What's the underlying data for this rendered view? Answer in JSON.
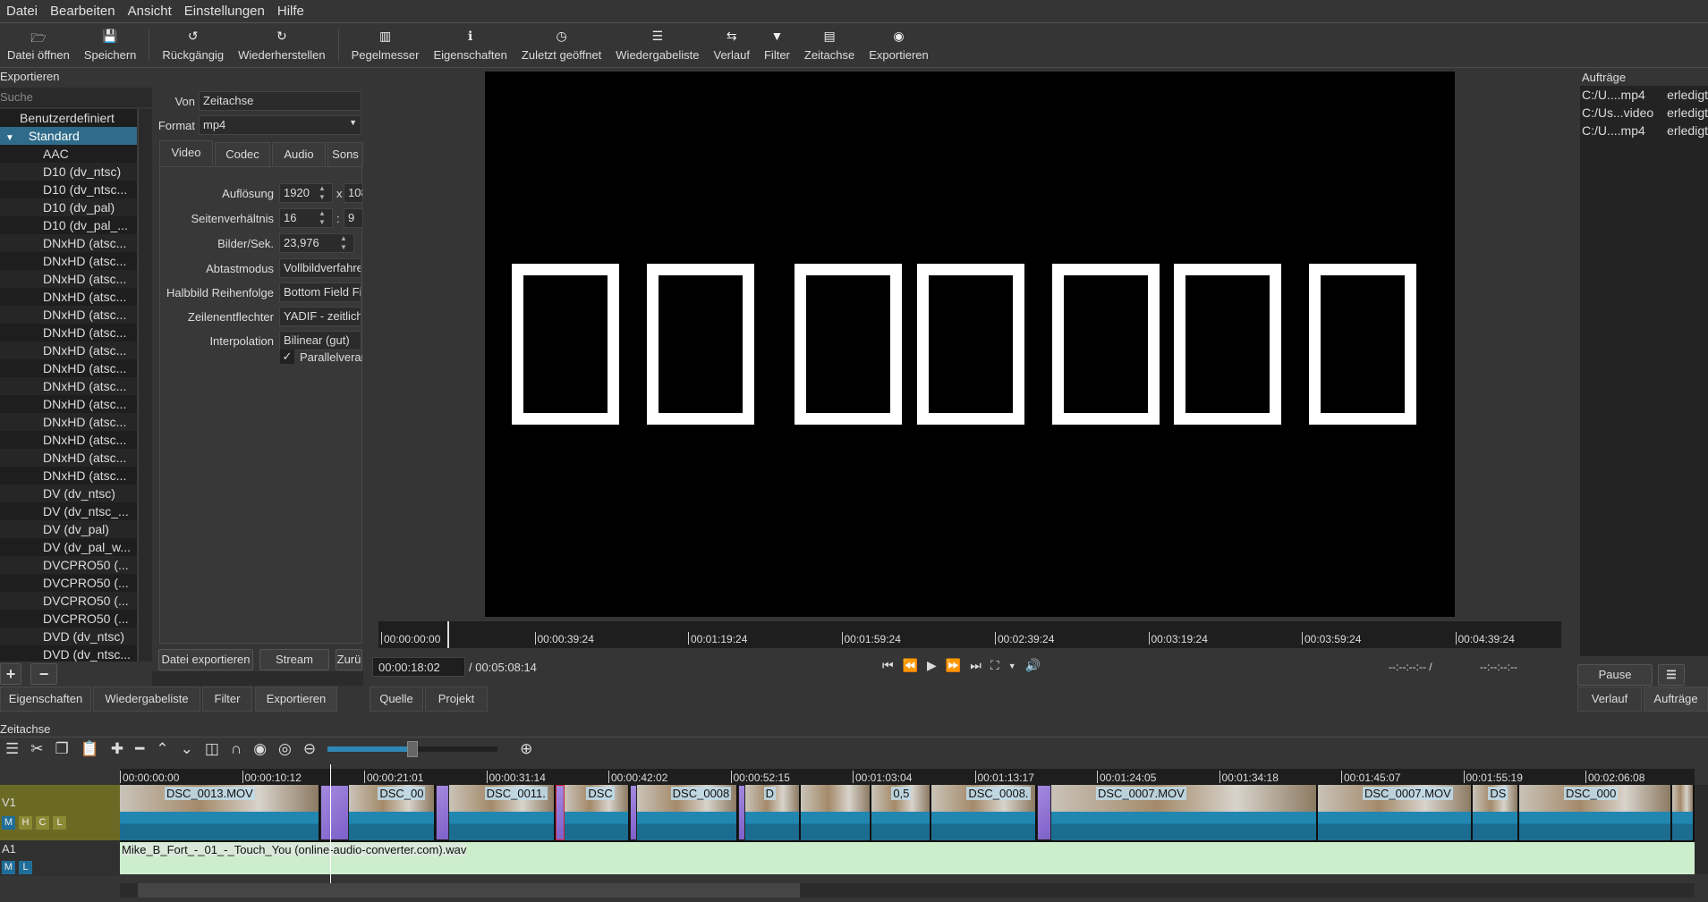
{
  "menu": [
    "Datei",
    "Bearbeiten",
    "Ansicht",
    "Einstellungen",
    "Hilfe"
  ],
  "toolbar": [
    {
      "icon": "folder-open-icon",
      "glyph": "🗁",
      "label": "Datei öffnen"
    },
    {
      "icon": "save-icon",
      "glyph": "💾",
      "label": "Speichern"
    },
    {
      "icon": "undo-icon",
      "glyph": "↺",
      "label": "Rückgängig"
    },
    {
      "icon": "redo-icon",
      "glyph": "↻",
      "label": "Wiederherstellen"
    },
    {
      "icon": "meter-icon",
      "glyph": "▥",
      "label": "Pegelmesser"
    },
    {
      "icon": "info-icon",
      "glyph": "ℹ",
      "label": "Eigenschaften"
    },
    {
      "icon": "clock-icon",
      "glyph": "◷",
      "label": "Zuletzt geöffnet"
    },
    {
      "icon": "list-icon",
      "glyph": "☰",
      "label": "Wiedergabeliste"
    },
    {
      "icon": "history-icon",
      "glyph": "⇆",
      "label": "Verlauf"
    },
    {
      "icon": "filter-icon",
      "glyph": "▼",
      "label": "Filter"
    },
    {
      "icon": "timeline-icon",
      "glyph": "▤",
      "label": "Zeitachse"
    },
    {
      "icon": "export-icon",
      "glyph": "◉",
      "label": "Exportieren"
    }
  ],
  "export": {
    "title": "Exportieren",
    "search_placeholder": "Suche",
    "presets": [
      "Benutzerdefiniert",
      "Standard",
      "AAC",
      "D10 (dv_ntsc)",
      "D10 (dv_ntsc...",
      "D10 (dv_pal)",
      "D10 (dv_pal_...",
      "DNxHD (atsc...",
      "DNxHD (atsc...",
      "DNxHD (atsc...",
      "DNxHD (atsc...",
      "DNxHD (atsc...",
      "DNxHD (atsc...",
      "DNxHD (atsc...",
      "DNxHD (atsc...",
      "DNxHD (atsc...",
      "DNxHD (atsc...",
      "DNxHD (atsc...",
      "DNxHD (atsc...",
      "DNxHD (atsc...",
      "DNxHD (atsc...",
      "DV (dv_ntsc)",
      "DV (dv_ntsc_...",
      "DV (dv_pal)",
      "DV (dv_pal_w...",
      "DVCPRO50 (...",
      "DVCPRO50 (...",
      "DVCPRO50 (...",
      "DVCPRO50 (...",
      "DVD (dv_ntsc)",
      "DVD (dv_ntsc..."
    ],
    "selected": "Standard",
    "von_label": "Von",
    "von_value": "Zeitachse",
    "format_label": "Format",
    "format_value": "mp4",
    "tabs": [
      "Video",
      "Codec",
      "Audio",
      "Sons"
    ],
    "fields": [
      {
        "label": "Auflösung",
        "value": "1920",
        "value2": "108",
        "sep": "x"
      },
      {
        "label": "Seitenverhältnis",
        "value": "16",
        "value2": "9",
        "sep": ":"
      },
      {
        "label": "Bilder/Sek.",
        "value": "23,976"
      },
      {
        "label": "Abtastmodus",
        "value": "Vollbildverfahre"
      },
      {
        "label": "Halbbild Reihenfolge",
        "value": "Bottom Field Fi"
      },
      {
        "label": "Zeilenentflechter",
        "value": "YADIF - zeitlich"
      },
      {
        "label": "Interpolation",
        "value": "Bilinear (gut)"
      }
    ],
    "parallel_label": "Parallelverar",
    "parallel_checked": true,
    "btn_export": "Datei exportieren",
    "btn_stream": "Stream",
    "btn_reset": "Zurü"
  },
  "left_tabs": [
    "Eigenschaften",
    "Wiedergabeliste",
    "Filter",
    "Exportieren"
  ],
  "player": {
    "ruler": [
      "00:00:00:00",
      "00:00:39:24",
      "00:01:19:24",
      "00:01:59:24",
      "00:02:39:24",
      "00:03:19:24",
      "00:03:59:24",
      "00:04:39:24"
    ],
    "position": "00:00:18:02",
    "duration": "/ 00:05:08:14",
    "in_point": "--:--:--:-- /",
    "out_point": "--:--:--:--",
    "tabs": [
      "Quelle",
      "Projekt"
    ]
  },
  "jobs": {
    "title": "Aufträge",
    "items": [
      {
        "name": "C:/U....mp4",
        "status": "erledigt"
      },
      {
        "name": "C:/Us...video",
        "status": "erledigt"
      },
      {
        "name": "C:/U....mp4",
        "status": "erledigt"
      }
    ],
    "pause": "Pause",
    "tabs": [
      "Verlauf",
      "Aufträge"
    ]
  },
  "timeline": {
    "title": "Zeitachse",
    "ruler": [
      "00:00:00:00",
      "00:00:10:12",
      "00:00:21:01",
      "00:00:31:14",
      "00:00:42:02",
      "00:00:52:15",
      "00:01:03:04",
      "00:01:13:17",
      "00:01:24:05",
      "00:01:34:18",
      "00:01:45:07",
      "00:01:55:19",
      "00:02:06:08"
    ],
    "zoom_level": 0.5,
    "v1": {
      "name": "V1",
      "buttons": [
        "M",
        "H",
        "C",
        "L"
      ]
    },
    "a1": {
      "name": "A1",
      "buttons": [
        "M",
        "L"
      ],
      "clip": "Mike_B_Fort_-_01_-_Touch_You (online-audio-converter.com).wav"
    },
    "clips": [
      "DSC_0013.MOV",
      "DSC_00",
      "DSC_0011.",
      "DSC",
      "DSC_0008",
      "D",
      "",
      "0,5",
      "DSC_0008.",
      "DSC_0007.MOV",
      "DSC_0007.MOV",
      "DS",
      "DSC_000",
      ""
    ],
    "colors": {
      "video_clip": "#2287b0",
      "audio_clip": "#cdeecd",
      "transition": "#a58ae0",
      "track_header": "#6b6a24"
    }
  }
}
